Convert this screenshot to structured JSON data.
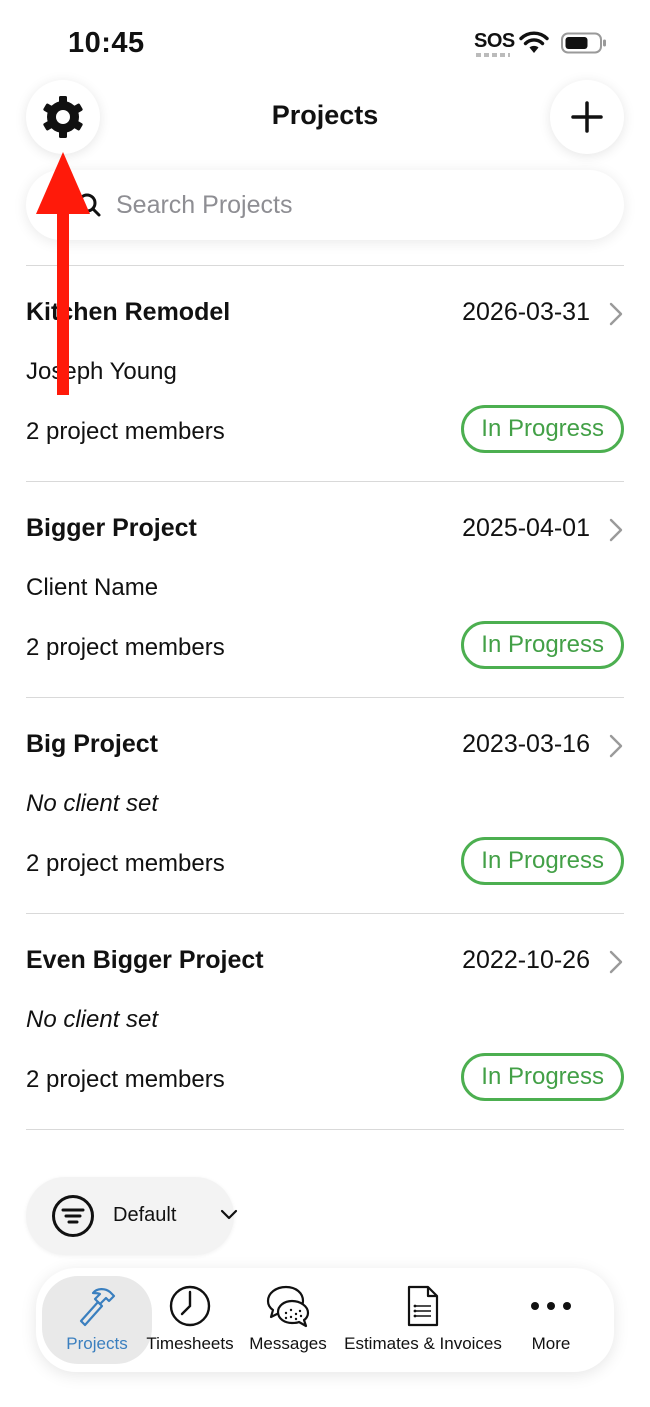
{
  "status_bar": {
    "time": "10:45",
    "sos": "SOS"
  },
  "header": {
    "title": "Projects"
  },
  "search": {
    "placeholder": "Search Projects"
  },
  "projects": [
    {
      "name": "Kitchen Remodel",
      "date": "2026-03-31",
      "client": "Joseph Young",
      "client_set": true,
      "members": "2 project members",
      "status": "In Progress"
    },
    {
      "name": "Bigger Project",
      "date": "2025-04-01",
      "client": "Client Name",
      "client_set": true,
      "members": "2 project members",
      "status": "In Progress"
    },
    {
      "name": "Big Project",
      "date": "2023-03-16",
      "client": "No client set",
      "client_set": false,
      "members": "2 project members",
      "status": "In Progress"
    },
    {
      "name": "Even Bigger Project",
      "date": "2022-10-26",
      "client": "No client set",
      "client_set": false,
      "members": "2 project members",
      "status": "In Progress"
    }
  ],
  "filter": {
    "label": "Default"
  },
  "tabs": [
    {
      "label": "Projects",
      "icon": "hammer-icon",
      "active": true
    },
    {
      "label": "Timesheets",
      "icon": "clock-icon",
      "active": false
    },
    {
      "label": "Messages",
      "icon": "chat-bubbles-icon",
      "active": false
    },
    {
      "label": "Estimates & Invoices",
      "icon": "document-icon",
      "active": false
    },
    {
      "label": "More",
      "icon": "ellipsis-icon",
      "active": false
    }
  ],
  "colors": {
    "status_green": "#43a047",
    "active_tab": "#3a7fbf",
    "annotation_arrow": "#ff1a0a"
  }
}
